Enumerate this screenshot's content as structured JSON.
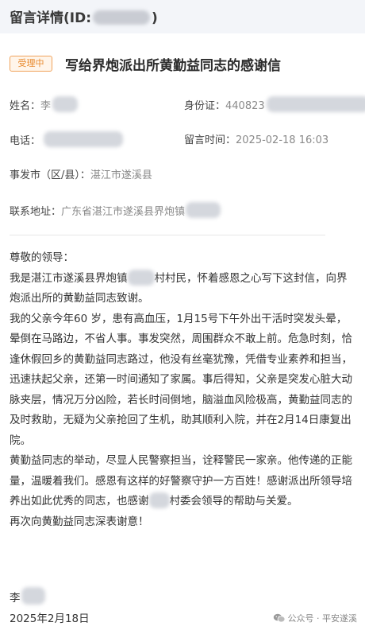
{
  "header": {
    "title_prefix": "留言详情(ID:",
    "title_suffix": ")"
  },
  "message": {
    "status": "受理中",
    "title": "写给界炮派出所黄勤益同志的感谢信"
  },
  "fields": {
    "name_label": "姓名：",
    "name_value": "李",
    "id_label": "身份证：",
    "id_value": "440823",
    "phone_label": "电话：",
    "time_label": "留言时间：",
    "time_value": "2025-02-18 16:03",
    "district_label": "事发市（区/县）：",
    "district_value": "湛江市遂溪县",
    "address_label": "联系地址：",
    "address_value": "广东省湛江市遂溪县界炮镇"
  },
  "letter": {
    "greeting": "尊敬的领导：",
    "p1a": "我是湛江市遂溪县界炮镇",
    "p1b": "村村民，怀着感恩之心写下这封信，向界炮派出所的黄勤益同志致谢。",
    "p2": "我的父亲今年60 岁，患有高血压，1月15号下午外出干活时突发头晕，晕倒在马路边，不省人事。事发突然，周围群众不敢上前。危急时刻，恰逢休假回乡的黄勤益同志路过，他没有丝毫犹豫，凭借专业素养和担当，迅速扶起父亲，还第一时间通知了家属。事后得知，父亲是突发心脏大动脉夹层，情况万分凶险，若长时间倒地，脑溢血风险极高，黄勤益同志的及时救助，无疑为父亲抢回了生机，助其顺利入院，并在2月14日康复出院。",
    "p3a": "黄勤益同志的举动，尽显人民警察担当，诠释警民一家亲。他传递的正能量，温暖着我们。感恩有这样的好警察守护一方百姓！感谢派出所领导培养出如此优秀的同志，也感谢",
    "p3b": "村委会领导的帮助与关爱。",
    "p4": "再次向黄勤益同志深表谢意！",
    "signature": "李",
    "date": "2025年2月18日"
  },
  "watermark": {
    "text": "公众号 · 平安遂溪",
    "icon": "wechat-icon"
  }
}
